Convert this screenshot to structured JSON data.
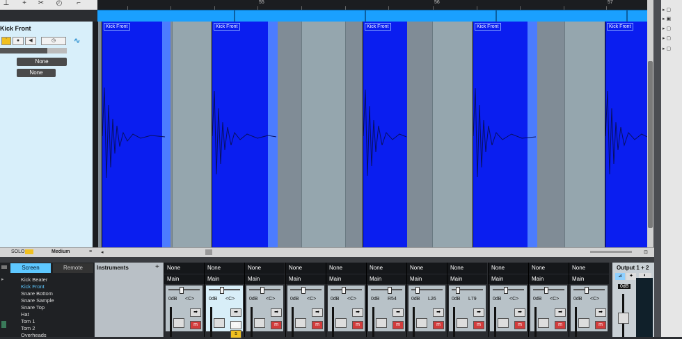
{
  "ruler": {
    "bars": [
      "55",
      "56",
      "57"
    ]
  },
  "inspector": {
    "track_name": "Kick Front",
    "solo_label": "SOLO",
    "size_label": "Medium",
    "input_label": "None",
    "output_label": "None"
  },
  "events": [
    {
      "label": "Kick Front"
    },
    {
      "label": "Kick Front"
    },
    {
      "label": "Kick Front"
    },
    {
      "label": "Kick Front"
    },
    {
      "label": "Kick Front"
    }
  ],
  "console": {
    "tabs": [
      "Screen",
      "Remote"
    ],
    "tracks": [
      "Kick Beater",
      "Kick Front",
      "Snare Bottom",
      "Snare Sample",
      "Snare Top",
      "Hat",
      "Tom 1",
      "Tom 2",
      "Overheads"
    ],
    "selected_track": "Kick Front",
    "instruments_title": "Instruments",
    "output_title": "Output 1 + 2",
    "output_db": "0dB"
  },
  "channels": [
    {
      "input": "None",
      "output": "Main",
      "volume": "0dB",
      "pan": "<C>"
    },
    {
      "input": "None",
      "output": "Main",
      "volume": "0dB",
      "pan": "<C>"
    },
    {
      "input": "None",
      "output": "Main",
      "volume": "0dB",
      "pan": "<C>"
    },
    {
      "input": "None",
      "output": "Main",
      "volume": "0dB",
      "pan": "<C>"
    },
    {
      "input": "None",
      "output": "Main",
      "volume": "0dB",
      "pan": "<C>"
    },
    {
      "input": "None",
      "output": "Main",
      "volume": "0dB",
      "pan": "R54"
    },
    {
      "input": "None",
      "output": "Main",
      "volume": "0dB",
      "pan": "L26"
    },
    {
      "input": "None",
      "output": "Main",
      "volume": "0dB",
      "pan": "L79"
    },
    {
      "input": "None",
      "output": "Main",
      "volume": "0dB",
      "pan": "<C>"
    },
    {
      "input": "None",
      "output": "Main",
      "volume": "0dB",
      "pan": "<C>"
    },
    {
      "input": "None",
      "output": "Main",
      "volume": "0dB",
      "pan": "<C>"
    }
  ],
  "colors": {
    "event": "#0a1ef0",
    "loop": "#1aa0ff",
    "inspector": "#d8effa",
    "mute": "#d23b3b"
  }
}
